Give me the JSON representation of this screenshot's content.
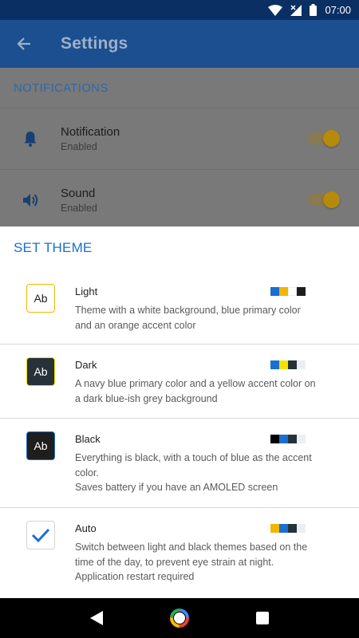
{
  "status_bar": {
    "time": "07:00"
  },
  "app_bar": {
    "title": "Settings"
  },
  "notifications_section": {
    "header": "NOTIFICATIONS",
    "items": [
      {
        "label": "Notification",
        "summary": "Enabled",
        "icon": "bell-icon",
        "enabled": true
      },
      {
        "label": "Sound",
        "summary": "Enabled",
        "icon": "speaker-icon",
        "enabled": true
      }
    ]
  },
  "theme_sheet": {
    "title": "SET THEME",
    "themes": [
      {
        "name": "Light",
        "preview_text": "Ab",
        "desc": "Theme with a white background, blue primary color and an orange accent color",
        "swatches": [
          "#1a6fd1",
          "#f2b600",
          "#ffffff",
          "#1e1e1e"
        ],
        "selected": false
      },
      {
        "name": "Dark",
        "preview_text": "Ab",
        "desc": "A navy blue primary color and a yellow accent color on a dark blue-ish grey background",
        "swatches": [
          "#1a6fd1",
          "#f5e100",
          "#263238",
          "#eceff1"
        ],
        "selected": false
      },
      {
        "name": "Black",
        "preview_text": "Ab",
        "desc": "Everything is black, with a touch of blue as the accent color.\nSaves battery if you have an AMOLED screen",
        "swatches": [
          "#000000",
          "#1a6fd1",
          "#263238",
          "#eceff1"
        ],
        "selected": false
      },
      {
        "name": "Auto",
        "preview_text": "",
        "desc": "Switch between light and black themes based on the time of the day, to prevent eye strain at night.\nApplication restart required",
        "swatches": [
          "#f2b600",
          "#1a6fd1",
          "#263238",
          "#eceff1"
        ],
        "selected": true
      }
    ]
  },
  "colors": {
    "accent": "#1a6fd1",
    "toggle_on": "#b68a0a",
    "app_bar": "#1b4f8f"
  }
}
